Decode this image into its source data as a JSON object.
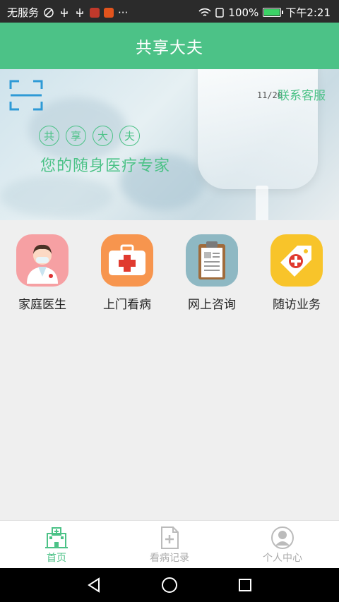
{
  "status_bar": {
    "carrier": "无服务",
    "battery": "100%",
    "time": "下午2:21",
    "more": "···"
  },
  "header": {
    "title": "共享大夫"
  },
  "banner": {
    "contact_label": "联系客服",
    "slogan_chars": [
      "共",
      "享",
      "大",
      "夫"
    ],
    "slogan": "您的随身医疗专家",
    "iv_label": "11/20"
  },
  "services": [
    {
      "label": "家庭医生",
      "icon": "doctor-icon",
      "color": "#f6a0a3"
    },
    {
      "label": "上门看病",
      "icon": "first-aid-kit-icon",
      "color": "#f7954e"
    },
    {
      "label": "网上咨询",
      "icon": "clipboard-icon",
      "color": "#8eb8c3"
    },
    {
      "label": "随访业务",
      "icon": "medical-tag-icon",
      "color": "#f8c42a"
    }
  ],
  "tabs": [
    {
      "label": "首页",
      "icon": "hospital-icon",
      "active": true
    },
    {
      "label": "看病记录",
      "icon": "document-plus-icon",
      "active": false
    },
    {
      "label": "个人中心",
      "icon": "user-icon",
      "active": false
    }
  ],
  "colors": {
    "primary": "#4cc287",
    "status_bar": "#2b2b2b",
    "background": "#efefef"
  }
}
